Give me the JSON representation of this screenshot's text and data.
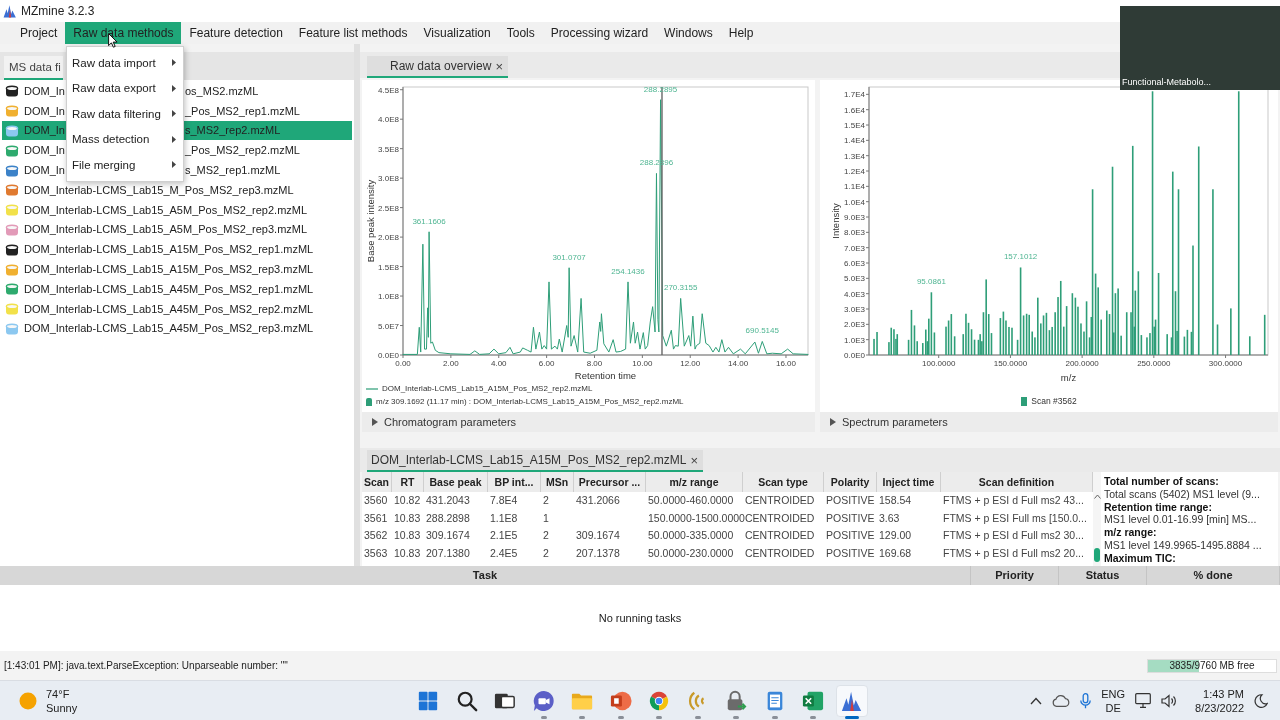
{
  "window": {
    "title": "MZmine 3.2.3"
  },
  "menu_bar": [
    {
      "label": "Project",
      "selected": false
    },
    {
      "label": "Raw data methods",
      "selected": true
    },
    {
      "label": "Feature detection",
      "selected": false
    },
    {
      "label": "Feature list methods",
      "selected": false
    },
    {
      "label": "Visualization",
      "selected": false
    },
    {
      "label": "Tools",
      "selected": false
    },
    {
      "label": "Processing wizard",
      "selected": false
    },
    {
      "label": "Windows",
      "selected": false
    },
    {
      "label": "Help",
      "selected": false
    }
  ],
  "open_menu": {
    "items": [
      {
        "label": "Raw data import",
        "submenu": true
      },
      {
        "label": "Raw data export",
        "submenu": true
      },
      {
        "label": "Raw data filtering",
        "submenu": true
      },
      {
        "label": "Mass detection",
        "submenu": true
      },
      {
        "label": "File merging",
        "submenu": true
      }
    ]
  },
  "video_tile": {
    "label": "Functional-Metabolo..."
  },
  "ms_data_panel": {
    "tab": {
      "label": "MS data fi",
      "selected": true
    },
    "files": [
      {
        "name_parts": [
          "DOM_In",
          "os_MS2.mzML"
        ],
        "color": "#222222",
        "selected": false
      },
      {
        "name_parts": [
          "DOM_In",
          "_Pos_MS2_rep1.mzML"
        ],
        "color": "#f0b030",
        "selected": false
      },
      {
        "name_parts": [
          "DOM_In",
          "s_MS2_rep2.mzML"
        ],
        "color": "#8cc8f0",
        "selected": true
      },
      {
        "name_parts": [
          "DOM_In",
          "_Pos_MS2_rep2.mzML"
        ],
        "color": "#2eaa6e",
        "selected": false
      },
      {
        "name_parts": [
          "DOM_In",
          "s_MS2_rep1.mzML"
        ],
        "color": "#3c82c8",
        "selected": false
      },
      {
        "name_parts": [
          "DOM_Interlab-LCMS_Lab15_M_Pos_MS2_rep3.mzML"
        ],
        "color": "#e07a30",
        "selected": false
      },
      {
        "name_parts": [
          "DOM_Interlab-LCMS_Lab15_A5M_Pos_MS2_rep2.mzML"
        ],
        "color": "#f2e14a",
        "selected": false
      },
      {
        "name_parts": [
          "DOM_Interlab-LCMS_Lab15_A5M_Pos_MS2_rep3.mzML"
        ],
        "color": "#e29ab8",
        "selected": false
      },
      {
        "name_parts": [
          "DOM_Interlab-LCMS_Lab15_A15M_Pos_MS2_rep1.mzML"
        ],
        "color": "#222222",
        "selected": false
      },
      {
        "name_parts": [
          "DOM_Interlab-LCMS_Lab15_A15M_Pos_MS2_rep3.mzML"
        ],
        "color": "#f0b030",
        "selected": false
      },
      {
        "name_parts": [
          "DOM_Interlab-LCMS_Lab15_A45M_Pos_MS2_rep1.mzML"
        ],
        "color": "#2eaa6e",
        "selected": false
      },
      {
        "name_parts": [
          "DOM_Interlab-LCMS_Lab15_A45M_Pos_MS2_rep2.mzML"
        ],
        "color": "#f2e14a",
        "selected": false
      },
      {
        "name_parts": [
          "DOM_Interlab-LCMS_Lab15_A45M_Pos_MS2_rep3.mzML"
        ],
        "color": "#8cc8f0",
        "selected": false
      }
    ]
  },
  "overview_tabs": [
    {
      "label": "Raw data overview",
      "close_glyph": "×",
      "selected": true
    }
  ],
  "chromatogram": {
    "chart_data": {
      "type": "line",
      "xlabel": "Retention time",
      "ylabel": "Base peak intensity",
      "x": [
        0,
        0.6,
        0.68,
        0.74,
        0.83,
        0.9,
        0.98,
        1.03,
        1.06,
        1.09,
        1.16,
        1.23,
        1.35,
        1.5,
        2.0,
        2.8,
        3.0,
        3.2,
        3.6,
        3.8,
        4.0,
        4.3,
        4.47,
        4.6,
        4.9,
        5.0,
        5.2,
        5.35,
        5.45,
        5.55,
        5.7,
        5.8,
        5.9,
        6.0,
        6.1,
        6.2,
        6.35,
        6.45,
        6.53,
        6.65,
        6.84,
        6.9,
        6.94,
        7.02,
        7.15,
        7.3,
        7.44,
        7.55,
        7.82,
        8.1,
        8.22,
        8.26,
        8.29,
        8.39,
        8.6,
        8.78,
        8.9,
        9.09,
        9.3,
        9.4,
        9.5,
        9.63,
        9.7,
        9.8,
        9.9,
        10.04,
        10.12,
        10.22,
        10.33,
        10.43,
        10.53,
        10.59,
        10.65,
        10.69,
        10.76,
        10.85,
        11.0,
        11.21,
        11.3,
        11.38,
        11.5,
        11.6,
        11.75,
        11.94,
        12.02,
        12.11,
        12.2,
        12.26,
        12.4,
        12.5,
        12.65,
        12.79,
        12.95,
        13.07,
        13.2,
        13.32,
        13.45,
        13.6,
        13.8,
        14.1,
        14.3,
        14.7,
        14.85,
        15.01,
        15.2,
        15.43,
        15.8,
        16.07,
        16.3,
        16.92
      ],
      "series": [
        {
          "color": "#2e9e78",
          "values": [
            1000000.0,
            1000000.0,
            47000000.0,
            5000000.0,
            188000000.0,
            10000000.0,
            10000000.0,
            80000000.0,
            30000000.0,
            209000000.0,
            20000000.0,
            22000000.0,
            8000000.0,
            4000000.0,
            2000000.0,
            1000000.0,
            7000000.0,
            1000000.0,
            2000000.0,
            10000000.0,
            2000000.0,
            4000000.0,
            13000000.0,
            2000000.0,
            5000000.0,
            12000000.0,
            8000000.0,
            5000000.0,
            47000000.0,
            10000000.0,
            39000000.0,
            10000000.0,
            16000000.0,
            10000000.0,
            124000000.0,
            10000000.0,
            15000000.0,
            10000000.0,
            27000000.0,
            5000000.0,
            50000000.0,
            30000000.0,
            148000000.0,
            15000000.0,
            33000000.0,
            5000000.0,
            96000000.0,
            5000000.0,
            3000000.0,
            8000000.0,
            56000000.0,
            40000000.0,
            70000000.0,
            19000000.0,
            5000000.0,
            26000000.0,
            5000000.0,
            6000000.0,
            10000000.0,
            124000000.0,
            20000000.0,
            56000000.0,
            20000000.0,
            39000000.0,
            10000000.0,
            38000000.0,
            10000000.0,
            16000000.0,
            56000000.0,
            82000000.0,
            39000000.0,
            308000000.0,
            60000000.0,
            39000000.0,
            433000000.0,
            33000000.0,
            15000000.0,
            42000000.0,
            10000000.0,
            16000000.0,
            15000000.0,
            96000000.0,
            15000000.0,
            33000000.0,
            15000000.0,
            66000000.0,
            10000000.0,
            16000000.0,
            20000000.0,
            70000000.0,
            20000000.0,
            16000000.0,
            5000000.0,
            13000000.0,
            5000000.0,
            26000000.0,
            5000000.0,
            13000000.0,
            2000000.0,
            10000000.0,
            2000000.0,
            22000000.0,
            3000000.0,
            23000000.0,
            2000000.0,
            3000000.0,
            2000000.0,
            10000000.0,
            2000000.0,
            1000000.0
          ]
        }
      ],
      "xlim": [
        0,
        16.92
      ],
      "ylim": [
        0,
        454600000.0
      ],
      "xticks": [
        {
          "value": 0,
          "label": "0.00"
        },
        {
          "value": 2,
          "label": "2.00"
        },
        {
          "value": 4,
          "label": "4.00"
        },
        {
          "value": 6,
          "label": "6.00"
        },
        {
          "value": 8,
          "label": "8.00"
        },
        {
          "value": 10,
          "label": "10.00"
        },
        {
          "value": 12,
          "label": "12.00"
        },
        {
          "value": 14,
          "label": "14.00"
        },
        {
          "value": 16,
          "label": "16.00"
        }
      ],
      "yticks": [
        {
          "value": 0,
          "label": "0.0E0"
        },
        {
          "value": 50000000.0,
          "label": "5.0E7"
        },
        {
          "value": 100000000.0,
          "label": "1.0E8"
        },
        {
          "value": 150000000.0,
          "label": "1.5E8"
        },
        {
          "value": 200000000.0,
          "label": "2.0E8"
        },
        {
          "value": 250000000.0,
          "label": "2.5E8"
        },
        {
          "value": 300000000.0,
          "label": "3.0E8"
        },
        {
          "value": 350000000.0,
          "label": "3.5E8"
        },
        {
          "value": 400000000.0,
          "label": "4.0E8"
        },
        {
          "value": 450000000.0,
          "label": "4.5E8"
        }
      ],
      "annotations": [
        {
          "x": 1.09,
          "y": 209000000.0,
          "text": "361.1606"
        },
        {
          "x": 6.94,
          "y": 148000000.0,
          "text": "301.0707"
        },
        {
          "x": 9.4,
          "y": 124000000.0,
          "text": "254.1436"
        },
        {
          "x": 10.76,
          "y": 433000000.0,
          "text": "288.2895"
        },
        {
          "x": 10.59,
          "y": 308000000.0,
          "text": "288.2896"
        },
        {
          "x": 11.6,
          "y": 96000000.0,
          "text": "270.3155"
        },
        {
          "x": 15.01,
          "y": 23000000.0,
          "text": "690.5145"
        }
      ],
      "ref_lines": [
        {
          "axis": "x",
          "value": 10.82
        }
      ]
    },
    "legend": [
      {
        "kind": "line",
        "label": "DOM_Interlab-LCMS_Lab15_A15M_Pos_MS2_rep2.mzML"
      },
      {
        "kind": "marker",
        "label": "m/z 309.1692 (11.17 min) : DOM_Interlab-LCMS_Lab15_A15M_Pos_MS2_rep2.mzML"
      }
    ],
    "parameters": {
      "label": "Chromatogram parameters",
      "expanded": false
    }
  },
  "spectrum": {
    "chart_data": {
      "type": "bar",
      "xlabel": "m/z",
      "ylabel": "Intensity",
      "x": [
        54.9,
        57.0,
        65.3,
        66.9,
        68.8,
        70.2,
        71.1,
        79.0,
        81.0,
        83.1,
        85.0,
        88.9,
        91.0,
        92.1,
        93.1,
        94.9,
        97.0,
        105.1,
        106.9,
        108.8,
        111.1,
        117.1,
        119.0,
        120.8,
        122.9,
        125.0,
        127.7,
        128.9,
        130.1,
        131.2,
        133.1,
        134.9,
        136.8,
        143.0,
        145.1,
        146.9,
        149.0,
        151.1,
        155.0,
        157.1,
        159.2,
        161.3,
        163.1,
        165.2,
        167.1,
        169.1,
        171.2,
        173.1,
        175.1,
        177.2,
        179.1,
        181.2,
        183.2,
        185.1,
        187.2,
        189.2,
        193.2,
        195.3,
        197.1,
        199.2,
        201.3,
        203.1,
        205.2,
        206.4,
        207.3,
        209.4,
        211.2,
        213.3,
        217.2,
        219.1,
        221.2,
        222.1,
        223.2,
        225.1,
        227.2,
        231.1,
        234.1,
        235.3,
        236.4,
        237.1,
        239.2,
        241.3,
        245.2,
        247.3,
        249.1,
        250.3,
        251.2,
        253.3,
        259.3,
        262.3,
        263.2,
        265.1,
        266.2,
        267.2,
        271.3,
        273.4,
        276.2,
        277.3,
        281.3,
        291.2,
        294.4,
        303.7,
        309.2,
        316.9,
        327.3
      ],
      "series": [
        {
          "color": "#2e9e78",
          "values": [
            1050,
            1500,
            840,
            1780,
            1680,
            1050,
            1360,
            990,
            2940,
            1930,
            900,
            780,
            1660,
            900,
            2370,
            4090,
            1470,
            1850,
            2250,
            2670,
            1220,
            1360,
            2690,
            2100,
            1680,
            1000,
            990,
            1360,
            900,
            2790,
            4930,
            2670,
            1430,
            2410,
            2830,
            2250,
            1830,
            1780,
            990,
            5710,
            2580,
            2690,
            2620,
            1530,
            1150,
            3740,
            2060,
            2580,
            2750,
            1620,
            1830,
            2790,
            3780,
            4830,
            1850,
            3190,
            4030,
            3740,
            3150,
            2060,
            1530,
            3500,
            1150,
            2480,
            10810,
            5310,
            4410,
            2310,
            2900,
            2670,
            12280,
            1470,
            4030,
            4340,
            1260,
            2790,
            2790,
            13640,
            1850,
            4200,
            5460,
            1300,
            1150,
            1430,
            17200,
            1850,
            2310,
            5350,
            1360,
            1150,
            11960,
            4160,
            1570,
            10810,
            1200,
            1640,
            1510,
            7140,
            13600,
            10810,
            1990,
            3040,
            17200,
            1220,
            2620
          ]
        }
      ],
      "xlim": [
        51.4,
        329.6
      ],
      "ylim": [
        0,
        17480
      ],
      "xticks": [
        {
          "value": 100,
          "label": "100.0000"
        },
        {
          "value": 150,
          "label": "150.0000"
        },
        {
          "value": 200,
          "label": "200.0000"
        },
        {
          "value": 250,
          "label": "250.0000"
        },
        {
          "value": 300,
          "label": "300.0000"
        }
      ],
      "yticks": [
        {
          "value": 0,
          "label": "0.0E0"
        },
        {
          "value": 1000,
          "label": "1.0E3"
        },
        {
          "value": 2000,
          "label": "2.0E3"
        },
        {
          "value": 3000,
          "label": "3.0E3"
        },
        {
          "value": 4000,
          "label": "4.0E3"
        },
        {
          "value": 5000,
          "label": "5.0E3"
        },
        {
          "value": 6000,
          "label": "6.0E3"
        },
        {
          "value": 7000,
          "label": "7.0E3"
        },
        {
          "value": 8000,
          "label": "8.0E3"
        },
        {
          "value": 9000,
          "label": "9.0E3"
        },
        {
          "value": 10000,
          "label": "1.0E4"
        },
        {
          "value": 11000,
          "label": "1.1E4"
        },
        {
          "value": 12000,
          "label": "1.2E4"
        },
        {
          "value": 13000,
          "label": "1.3E4"
        },
        {
          "value": 14000,
          "label": "1.4E4"
        },
        {
          "value": 15000,
          "label": "1.5E4"
        },
        {
          "value": 16000,
          "label": "1.6E4"
        },
        {
          "value": 17000,
          "label": "1.7E4"
        }
      ],
      "annotations": [
        {
          "x": 94.9,
          "y": 4090,
          "text": "95.0861"
        },
        {
          "x": 157.1,
          "y": 5710,
          "text": "157.1012"
        }
      ]
    },
    "legend": [
      {
        "kind": "marker",
        "label": "Scan #3562"
      }
    ],
    "parameters": {
      "label": "Spectrum parameters",
      "expanded": false
    }
  },
  "scan_tabs": [
    {
      "label": "DOM_Interlab-LCMS_Lab15_A15M_Pos_MS2_rep2.mzML",
      "close_glyph": "×",
      "selected": true
    }
  ],
  "scan_table": {
    "columns": [
      "Scan",
      "RT",
      "Base peak",
      "BP int...",
      "MSn",
      "Precursor ...",
      "m/z range",
      "Scan type",
      "Polarity",
      "Inject time",
      "Scan definition"
    ],
    "rows": [
      [
        "3560",
        "10.82",
        "431.2043",
        "7.8E4",
        "2",
        "431.2066",
        "50.0000-460.0000",
        "CENTROIDED",
        "POSITIVE",
        "158.54",
        "FTMS + p ESI d Full ms2 43..."
      ],
      [
        "3561",
        "10.83",
        "288.2898",
        "1.1E8",
        "1",
        null,
        "150.0000-1500.0000",
        "CENTROIDED",
        "POSITIVE",
        "3.63",
        "FTMS + p ESI Full ms [150.0..."
      ],
      [
        "3562",
        "10.83",
        "309.1674",
        "2.1E5",
        "2",
        "309.1674",
        "50.0000-335.0000",
        "CENTROIDED",
        "POSITIVE",
        "129.00",
        "FTMS + p ESI d Full ms2 30..."
      ],
      [
        "3563",
        "10.83",
        "207.1380",
        "2.4E5",
        "2",
        "207.1378",
        "50.0000-230.0000",
        "CENTROIDED",
        "POSITIVE",
        "169.68",
        "FTMS + p ESI d Full ms2 20..."
      ]
    ]
  },
  "file_info": [
    {
      "kind": "heading",
      "text": "Total number of scans:"
    },
    {
      "kind": "value",
      "text": "Total scans (5402) MS1 level (9..."
    },
    {
      "kind": "heading",
      "text": "Retention time range:"
    },
    {
      "kind": "value",
      "text": "MS1 level 0.01-16.99 [min] MS..."
    },
    {
      "kind": "heading",
      "text": "m/z range:"
    },
    {
      "kind": "value",
      "text": "MS1 level 149.9965-1495.8884 ..."
    },
    {
      "kind": "heading",
      "text": "Maximum TIC:"
    }
  ],
  "tasks": {
    "columns": [
      "Task",
      "Priority",
      "Status",
      "% done"
    ],
    "empty_text": "No running tasks"
  },
  "status_bar": {
    "message": "[1:43:01 PM]: java.text.ParseException: Unparseable number: \"\"",
    "memory": {
      "text": "3835/9760 MB free",
      "level": 0.4
    }
  },
  "taskbar": {
    "weather": {
      "temperature": "74°F",
      "condition": "Sunny"
    },
    "apps": [
      {
        "running": false,
        "selected": false
      },
      {
        "running": false,
        "selected": false
      },
      {
        "running": false,
        "selected": false
      },
      {
        "running": true,
        "selected": false
      },
      {
        "running": true,
        "selected": false
      },
      {
        "running": true,
        "selected": false
      },
      {
        "running": true,
        "selected": false
      },
      {
        "running": true,
        "selected": false
      },
      {
        "running": true,
        "selected": false
      },
      {
        "running": true,
        "selected": false
      },
      {
        "running": true,
        "selected": false
      },
      {
        "running": true,
        "selected": true
      }
    ],
    "language": {
      "primary": "ENG",
      "secondary": "DE"
    },
    "clock": {
      "time": "1:43 PM",
      "date": "8/23/2022"
    }
  }
}
